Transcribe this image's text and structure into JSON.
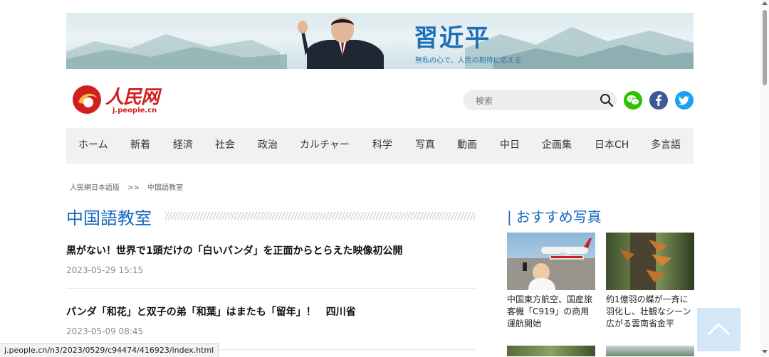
{
  "banner": {
    "title": "習近平",
    "subtitle": "無私の心で、人民の期待に応える"
  },
  "logo": {
    "name": "人民网",
    "url": "j.people.cn"
  },
  "search": {
    "placeholder": "検索"
  },
  "nav": {
    "items": [
      "ホーム",
      "新着",
      "経済",
      "社会",
      "政治",
      "カルチャー",
      "科学",
      "写真",
      "動画",
      "中日",
      "企画集",
      "日本CH",
      "多言語"
    ]
  },
  "breadcrumb": {
    "home": "人民網日本語版",
    "separator": ">>",
    "current": "中国語教室"
  },
  "section": {
    "title": "中国語教室"
  },
  "articles": [
    {
      "title": "黒がない！世界で1頭だけの「白いパンダ」を正面からとらえた映像初公開",
      "date": "2023-05-29 15:15"
    },
    {
      "title": "パンダ「和花」と双子の弟「和葉」はまたも「留年」！　四川省",
      "date": "2023-05-09 08:45"
    }
  ],
  "recommended": {
    "title": "おすすめ写真",
    "bar": "|",
    "items": [
      {
        "caption": "中国東方航空、国産旅客機「C919」の商用運航開始"
      },
      {
        "caption": "約1億羽の蝶が一斉に羽化し、壮観なシーン広がる雲南省金平"
      }
    ]
  },
  "status_bar": {
    "url": "j.people.cn/n3/2023/0529/c94474/416923/index.html"
  },
  "colors": {
    "accent": "#1769c2",
    "logo_red": "#d11f1f",
    "nav_bg": "#f1f1f1",
    "wechat": "#2dc100",
    "facebook": "#3b5998",
    "twitter": "#1da1f2"
  },
  "icons": {
    "search": "search-icon",
    "wechat": "wechat-icon",
    "facebook": "facebook-icon",
    "twitter": "twitter-icon",
    "back_to_top": "chevron-up-icon"
  }
}
